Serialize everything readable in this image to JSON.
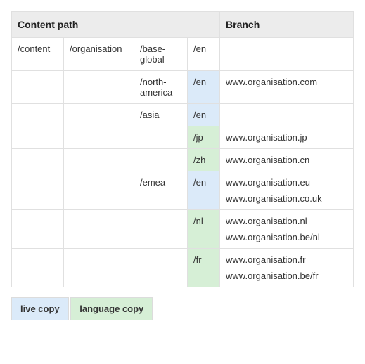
{
  "table": {
    "headers": {
      "content_path": "Content path",
      "branch": "Branch"
    },
    "rows": [
      {
        "c1": "/content",
        "c2": "/organisation",
        "c3": "/base-global",
        "c4": "/en",
        "c4class": "",
        "branch": []
      },
      {
        "c1": "",
        "c2": "",
        "c3": "/north-america",
        "c4": "/en",
        "c4class": "blue-cell",
        "branch": [
          "www.organisation.com"
        ]
      },
      {
        "c1": "",
        "c2": "",
        "c3": "/asia",
        "c4": "/en",
        "c4class": "blue-cell",
        "branch": []
      },
      {
        "c1": "",
        "c2": "",
        "c3": "",
        "c4": "/jp",
        "c4class": "green-cell",
        "branch": [
          "www.organisation.jp"
        ]
      },
      {
        "c1": "",
        "c2": "",
        "c3": "",
        "c4": "/zh",
        "c4class": "green-cell",
        "branch": [
          "www.organisation.cn"
        ]
      },
      {
        "c1": "",
        "c2": "",
        "c3": "/emea",
        "c4": "/en",
        "c4class": "blue-cell",
        "branch": [
          "www.organisation.eu",
          "www.organisation.co.uk"
        ]
      },
      {
        "c1": "",
        "c2": "",
        "c3": "",
        "c4": "/nl",
        "c4class": "green-cell",
        "branch": [
          "www.organisation.nl",
          "www.organisation.be/nl"
        ]
      },
      {
        "c1": "",
        "c2": "",
        "c3": "",
        "c4": "/fr",
        "c4class": "green-cell",
        "branch": [
          "www.organisation.fr",
          "www.organisation.be/fr"
        ]
      }
    ]
  },
  "legend": {
    "live_copy": "live copy",
    "language_copy": "language copy"
  }
}
